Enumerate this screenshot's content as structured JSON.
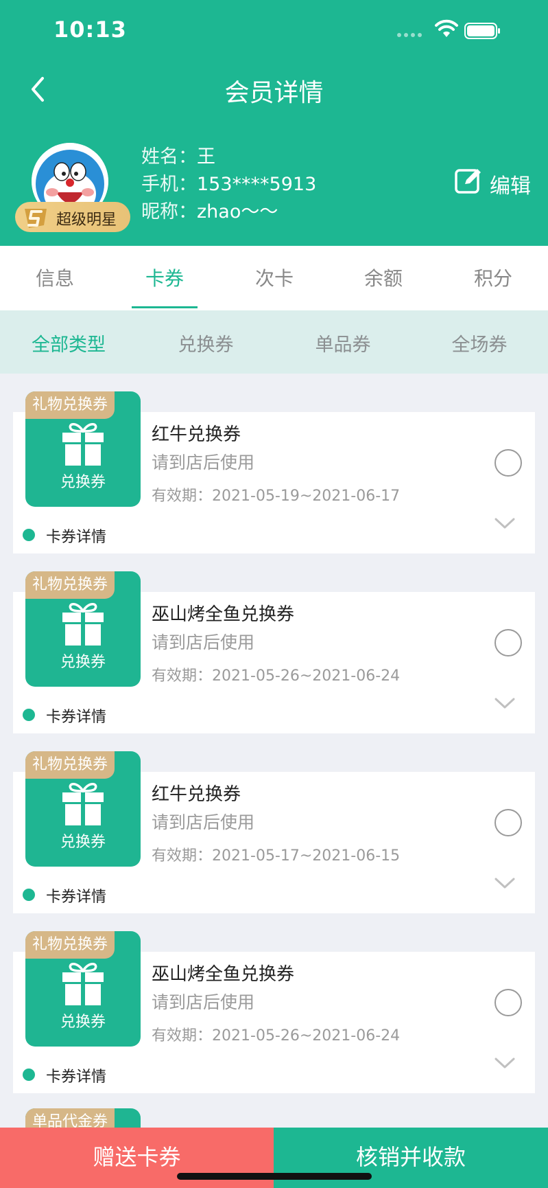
{
  "status_bar": {
    "time": "10:13"
  },
  "header": {
    "title": "会员详情",
    "edit_label": "编辑"
  },
  "member": {
    "badge": "超级明星",
    "name_label": "姓名：",
    "name": "王",
    "phone_label": "手机：",
    "phone": "153****5913",
    "nickname_label": "昵称：",
    "nickname": "zhao～～"
  },
  "tabs": [
    {
      "label": "信息",
      "active": false
    },
    {
      "label": "卡券",
      "active": true
    },
    {
      "label": "次卡",
      "active": false
    },
    {
      "label": "余额",
      "active": false
    },
    {
      "label": "积分",
      "active": false
    }
  ],
  "subtabs": [
    {
      "label": "全部类型",
      "active": true
    },
    {
      "label": "兑换券",
      "active": false
    },
    {
      "label": "单品券",
      "active": false
    },
    {
      "label": "全场券",
      "active": false
    }
  ],
  "coupons": [
    {
      "tag": "礼物兑换券",
      "thumb_label": "兑换券",
      "name": "红牛兑换券",
      "desc": "请到店后使用",
      "validity_label": "有效期：",
      "validity": "2021-05-19~2021-06-17",
      "detail_label": "卡券详情"
    },
    {
      "tag": "礼物兑换券",
      "thumb_label": "兑换券",
      "name": "巫山烤全鱼兑换券",
      "desc": "请到店后使用",
      "validity_label": "有效期：",
      "validity": "2021-05-26~2021-06-24",
      "detail_label": "卡券详情"
    },
    {
      "tag": "礼物兑换券",
      "thumb_label": "兑换券",
      "name": "红牛兑换券",
      "desc": "请到店后使用",
      "validity_label": "有效期：",
      "validity": "2021-05-17~2021-06-15",
      "detail_label": "卡券详情"
    },
    {
      "tag": "礼物兑换券",
      "thumb_label": "兑换券",
      "name": "巫山烤全鱼兑换券",
      "desc": "请到店后使用",
      "validity_label": "有效期：",
      "validity": "2021-05-26~2021-06-24",
      "detail_label": "卡券详情"
    }
  ],
  "partial_coupon": {
    "tag": "单品代金券"
  },
  "bottom_actions": {
    "gift_label": "赠送卡券",
    "verify_label": "核销并收款"
  },
  "colors": {
    "primary": "#1db792",
    "gift_button": "#f86b68",
    "tag_gold": "#d6b787"
  },
  "icons": [
    "back-arrow-icon",
    "wifi-icon",
    "battery-icon",
    "edit-icon",
    "gift-icon",
    "chevron-down-icon"
  ]
}
